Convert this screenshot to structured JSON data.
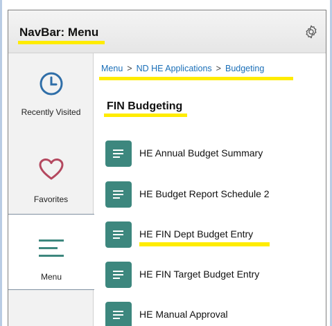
{
  "navbar": {
    "title": "NavBar: Menu"
  },
  "sidebar": {
    "items": [
      {
        "label": "Recently Visited",
        "icon": "clock-icon"
      },
      {
        "label": "Favorites",
        "icon": "heart-icon"
      },
      {
        "label": "Menu",
        "icon": "menu-icon",
        "selected": true
      }
    ]
  },
  "breadcrumb": {
    "items": [
      "Menu",
      "ND HE Applications",
      "Budgeting"
    ]
  },
  "content": {
    "title": "FIN Budgeting",
    "items": [
      {
        "label": "HE Annual Budget Summary"
      },
      {
        "label": "HE Budget Report Schedule 2"
      },
      {
        "label": "HE FIN Dept Budget Entry"
      },
      {
        "label": "HE FIN Target Budget Entry"
      },
      {
        "label": "HE Manual Approval"
      }
    ]
  },
  "colors": {
    "accent_blue": "#1a6fb8",
    "app_icon_teal": "#3d877e",
    "highlight_yellow": "#ffec00",
    "heart": "#b4485f",
    "clock": "#2f6ea8"
  }
}
